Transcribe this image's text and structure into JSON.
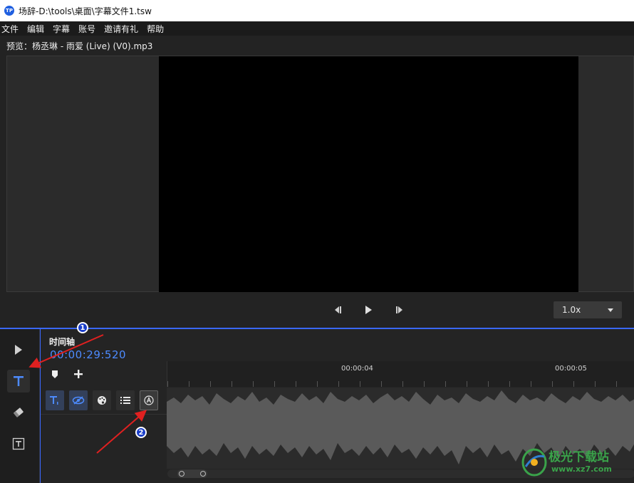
{
  "window": {
    "title": "场辞-D:\\tools\\桌面\\字幕文件1.tsw",
    "logo_text": "TP"
  },
  "menu": [
    "文件",
    "编辑",
    "字幕",
    "账号",
    "邀请有礼",
    "帮助"
  ],
  "preview": {
    "label": "预览：杨丞琳 - 雨爱 (Live) (V0).mp3"
  },
  "player": {
    "speed": "1.0x"
  },
  "timeline": {
    "title": "时间轴",
    "current_time": "00:00:29:520",
    "ruler_labels": [
      "00:00:04",
      "00:00:05"
    ]
  },
  "annotations": [
    "1",
    "2"
  ],
  "watermark": {
    "text": "极光下载站",
    "url": "www.xz7.com"
  },
  "colors": {
    "accent": "#4d8bff",
    "annotation_arrow": "#e02020",
    "badge": "#1a3ec9"
  }
}
